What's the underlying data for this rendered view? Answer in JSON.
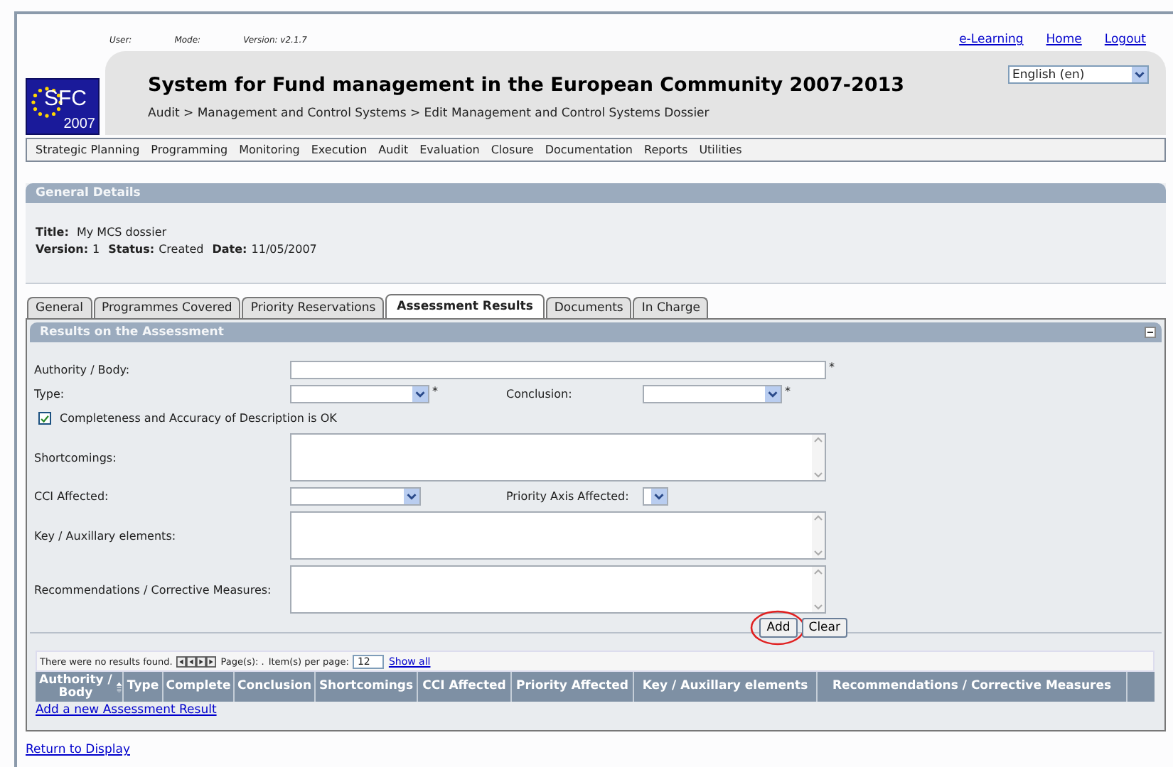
{
  "user_bar": {
    "fields": [
      "User:",
      "Mode:",
      "Version: v2.1.7"
    ],
    "links": [
      "e-Learning",
      "Home",
      "Logout"
    ]
  },
  "header": {
    "logo": {
      "text": "SFC",
      "year": "2007"
    },
    "title": "System for Fund management in the European Community 2007-2013",
    "breadcrumb": "Audit > Management and Control Systems > Edit Management and Control Systems Dossier",
    "language": "English (en)"
  },
  "menu": [
    "Strategic Planning",
    "Programming",
    "Monitoring",
    "Execution",
    "Audit",
    "Evaluation",
    "Closure",
    "Documentation",
    "Reports",
    "Utilities"
  ],
  "general_details": {
    "heading": "General Details",
    "rows": [
      [
        {
          "label": "Title:",
          "value": "My MCS dossier"
        }
      ],
      [
        {
          "label": "Version:",
          "value": "1"
        },
        {
          "label": "Status:",
          "value": "Created"
        },
        {
          "label": "Date:",
          "value": "11/05/2007"
        }
      ]
    ]
  },
  "tabs": [
    {
      "label": "General",
      "selected": false
    },
    {
      "label": "Programmes Covered",
      "selected": false
    },
    {
      "label": "Priority Reservations",
      "selected": false
    },
    {
      "label": "Assessment Results",
      "selected": true
    },
    {
      "label": "Documents",
      "selected": false
    },
    {
      "label": "In Charge",
      "selected": false
    }
  ],
  "panel": {
    "heading": "Results on the Assessment",
    "rows": [
      {
        "fields": [
          {
            "kind": "text",
            "label": "Authority / Body:",
            "mark": "*"
          }
        ]
      },
      {
        "fields": [
          {
            "kind": "select",
            "label": "Type:",
            "mark": "*"
          },
          {
            "kind": "select",
            "label": "Conclusion:",
            "mark": "*"
          }
        ]
      },
      {
        "fields": [
          {
            "kind": "checkbox",
            "label": "Completeness and Accuracy of Description is OK",
            "checked": true
          }
        ]
      },
      {
        "fields": [
          {
            "kind": "textarea",
            "label": "Shortcomings:"
          }
        ]
      },
      {
        "fields": [
          {
            "kind": "select",
            "label": "CCI Affected:"
          },
          {
            "kind": "smallselect",
            "label": "Priority Axis Affected:"
          }
        ]
      },
      {
        "fields": [
          {
            "kind": "textarea",
            "label": "Key / Auxillary elements:"
          }
        ]
      },
      {
        "fields": [
          {
            "kind": "textarea",
            "label": "Recommendations / Corrective Measures:"
          }
        ]
      }
    ],
    "buttons": [
      {
        "label": "Add",
        "circled": true
      },
      {
        "label": "Clear",
        "circled": false
      }
    ],
    "grid": {
      "message": "There were no results found.",
      "pages_label": "Page(s): .",
      "per_page_label": "Item(s) per page:",
      "per_page": "12",
      "show_all": "Show all",
      "columns": [
        {
          "label": "Authority / Body",
          "sortable": true
        },
        {
          "label": "Type",
          "sortable": false
        },
        {
          "label": "Complete",
          "sortable": false
        },
        {
          "label": "Conclusion",
          "sortable": false
        },
        {
          "label": "Shortcomings",
          "sortable": false
        },
        {
          "label": "CCI Affected",
          "sortable": false
        },
        {
          "label": "Priority Affected",
          "sortable": false
        },
        {
          "label": "Key / Auxillary elements",
          "sortable": false
        },
        {
          "label": "Recommendations / Corrective Measures",
          "sortable": false
        }
      ]
    },
    "add_link": "Add a new Assessment Result"
  },
  "return_link": "Return to Display"
}
